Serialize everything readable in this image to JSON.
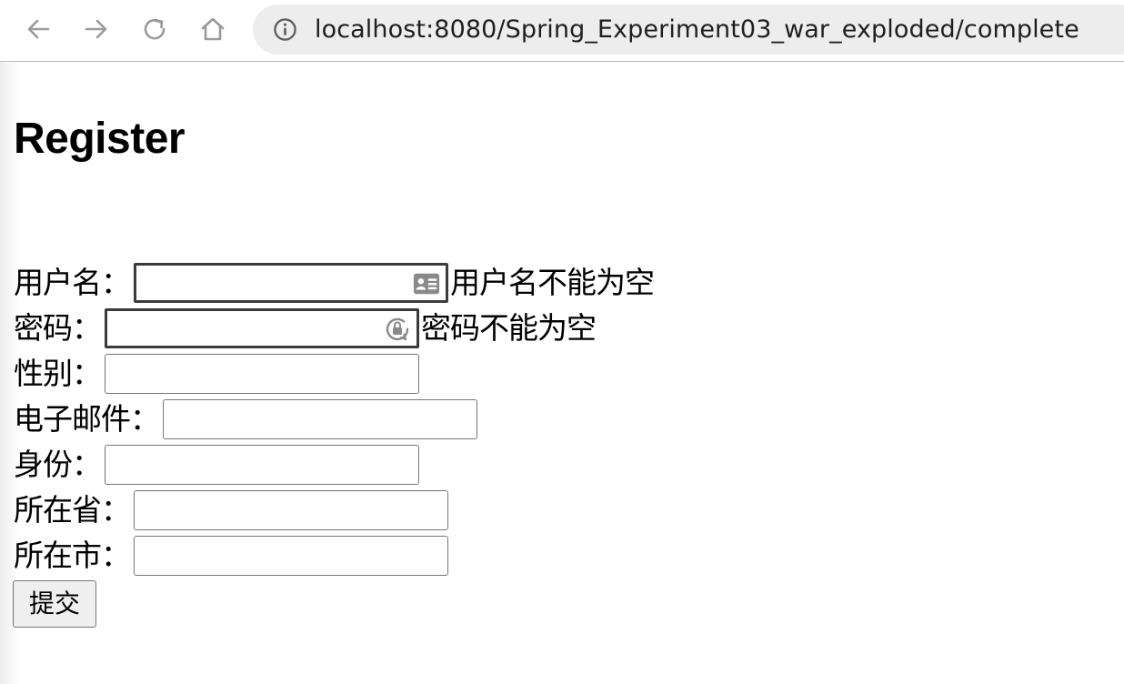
{
  "browser": {
    "url": "localhost:8080/Spring_Experiment03_war_exploded/complete"
  },
  "page": {
    "title": "Register",
    "fields": [
      {
        "label": "用户名：",
        "value": "",
        "error": "用户名不能为空",
        "icon": "contact-card-icon"
      },
      {
        "label": "密码：",
        "value": "",
        "error": "密码不能为空",
        "icon": "password-lock-icon"
      },
      {
        "label": "性别：",
        "value": "",
        "error": ""
      },
      {
        "label": "电子邮件：",
        "value": "",
        "error": ""
      },
      {
        "label": "身份：",
        "value": "",
        "error": ""
      },
      {
        "label": "所在省：",
        "value": "",
        "error": ""
      },
      {
        "label": "所在市：",
        "value": "",
        "error": ""
      }
    ],
    "submit_label": "提交"
  }
}
